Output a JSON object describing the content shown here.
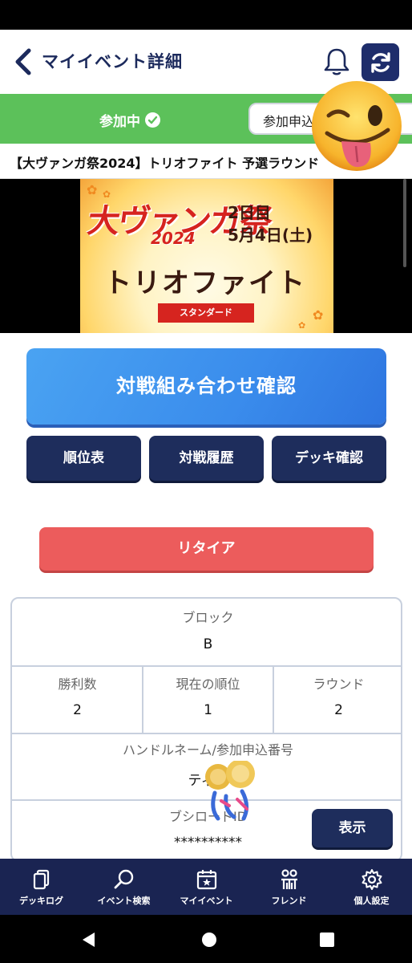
{
  "header": {
    "title": "マイイベント詳細"
  },
  "status": {
    "label": "参加中",
    "pill_text": "参加申込"
  },
  "event": {
    "title": "【大ヴァンガ祭2024】トリオファイト 予選ラウンド"
  },
  "banner": {
    "logo": "大ヴァンガ祭",
    "year": "2024",
    "day_line1": "2日目",
    "day_line2": "5月4日(土)",
    "main": "トリオファイト",
    "badge": "スタンダード"
  },
  "actions": {
    "match_check": "対戦組み合わせ確認",
    "standings": "順位表",
    "history": "対戦履歴",
    "deck_check": "デッキ確認",
    "retire": "リタイア",
    "show": "表示"
  },
  "info": {
    "block_label": "ブロック",
    "block_value": "B",
    "wins_label": "勝利数",
    "wins_value": "2",
    "rank_label": "現在の順位",
    "rank_value": "1",
    "round_label": "ラウンド",
    "round_value": "2",
    "handle_label": "ハンドルネーム/参加申込番号",
    "handle_value": "ティア",
    "bushiroad_label": "ブシロードID",
    "bushiroad_value": "**********"
  },
  "bottom_nav": [
    {
      "label": "デッキログ",
      "icon": "cards-icon"
    },
    {
      "label": "イベント検索",
      "icon": "search-icon"
    },
    {
      "label": "マイイベント",
      "icon": "calendar-star-icon"
    },
    {
      "label": "フレンド",
      "icon": "friends-icon"
    },
    {
      "label": "個人設定",
      "icon": "gear-icon"
    }
  ],
  "colors": {
    "navy": "#1e2d5c",
    "green": "#5cc15a",
    "blue": "#3a8cec",
    "red": "#ec5c5c"
  }
}
